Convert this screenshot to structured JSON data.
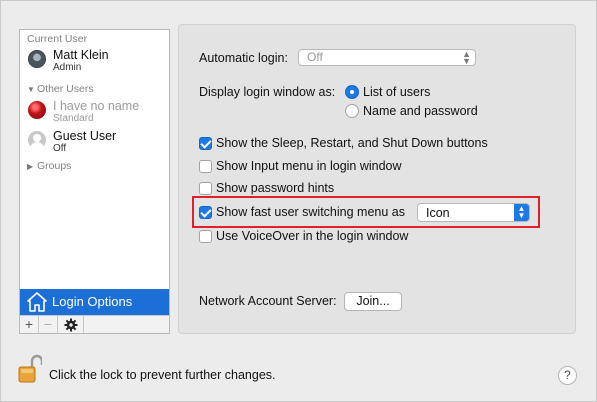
{
  "sidebar": {
    "current_user_label": "Current User",
    "current_user": {
      "name": "Matt Klein",
      "role": "Admin"
    },
    "other_users_label": "Other Users",
    "other_users": [
      {
        "name": "I have no name",
        "role": "Standard"
      },
      {
        "name": "Guest User",
        "role": "Off"
      }
    ],
    "groups_label": "Groups",
    "selected_item": "Login Options",
    "toolbar": {
      "add": "+",
      "remove": "−",
      "gear_icon": "gear-icon"
    }
  },
  "panel": {
    "automatic_login_label": "Automatic login:",
    "automatic_login_value": "Off",
    "display_login_label": "Display login window as:",
    "display_options": [
      {
        "label": "List of users",
        "selected": true
      },
      {
        "label": "Name and password",
        "selected": false
      }
    ],
    "checkboxes": [
      {
        "label": "Show the Sleep, Restart, and Shut Down buttons",
        "checked": true
      },
      {
        "label": "Show Input menu in login window",
        "checked": false
      },
      {
        "label": "Show password hints",
        "checked": false
      },
      {
        "label": "Show fast user switching menu as",
        "checked": true
      },
      {
        "label": "Use VoiceOver in the login window",
        "checked": false
      }
    ],
    "fast_switching_value": "Icon",
    "network_server_label": "Network Account Server:",
    "join_button": "Join..."
  },
  "footer": {
    "lock_text": "Click the lock to prevent further changes.",
    "help_label": "?"
  },
  "colors": {
    "accent": "#1e78e6",
    "selection": "#1d6fd8",
    "highlight": "#e0212b"
  }
}
